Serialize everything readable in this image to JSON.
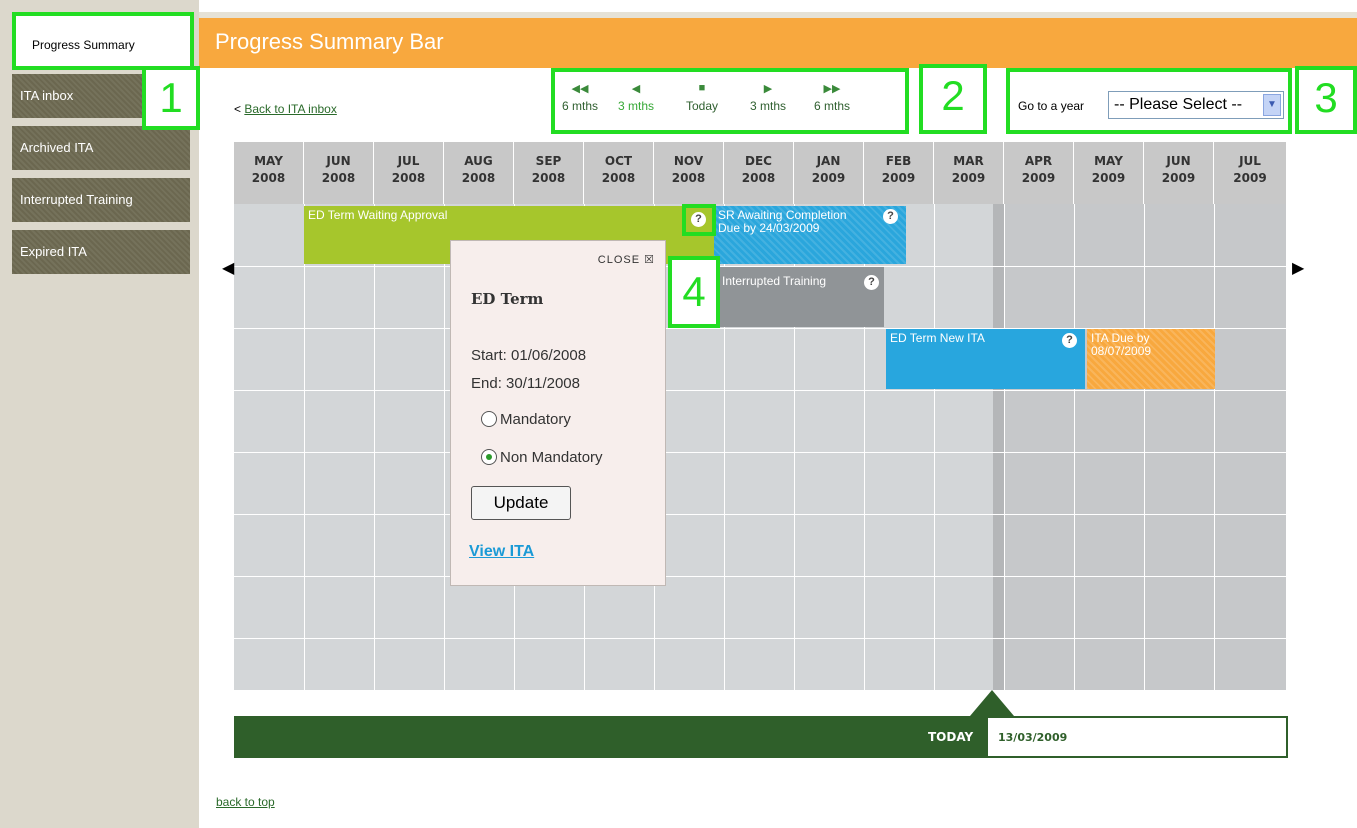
{
  "sidebar": {
    "items": [
      {
        "label": "Progress Summary"
      },
      {
        "label": "ITA inbox"
      },
      {
        "label": "Archived ITA"
      },
      {
        "label": "Interrupted Training"
      },
      {
        "label": "Expired ITA"
      }
    ]
  },
  "header": {
    "title": "Progress Summary Bar"
  },
  "back_link": {
    "prefix": "< ",
    "label": "Back to ITA inbox"
  },
  "nav": {
    "buttons": [
      {
        "icon": "double-left-arrow-icon",
        "glyph": "◀◀",
        "label": "6 mths"
      },
      {
        "icon": "left-arrow-icon",
        "glyph": "◀",
        "label": "3 mths"
      },
      {
        "icon": "stop-square-icon",
        "glyph": "■",
        "label": "Today"
      },
      {
        "icon": "right-arrow-icon",
        "glyph": "▶",
        "label": "3 mths"
      },
      {
        "icon": "double-right-arrow-icon",
        "glyph": "▶▶",
        "label": "6 mths"
      }
    ]
  },
  "year_select": {
    "label": "Go to a year",
    "value": "-- Please Select --"
  },
  "callouts": [
    "1",
    "2",
    "3",
    "4"
  ],
  "months": [
    {
      "m": "MAY",
      "y": "2008"
    },
    {
      "m": "JUN",
      "y": "2008"
    },
    {
      "m": "JUL",
      "y": "2008"
    },
    {
      "m": "AUG",
      "y": "2008"
    },
    {
      "m": "SEP",
      "y": "2008"
    },
    {
      "m": "OCT",
      "y": "2008"
    },
    {
      "m": "NOV",
      "y": "2008"
    },
    {
      "m": "DEC",
      "y": "2008"
    },
    {
      "m": "JAN",
      "y": "2009"
    },
    {
      "m": "FEB",
      "y": "2009"
    },
    {
      "m": "MAR",
      "y": "2009"
    },
    {
      "m": "APR",
      "y": "2009"
    },
    {
      "m": "MAY",
      "y": "2009"
    },
    {
      "m": "JUN",
      "y": "2009"
    },
    {
      "m": "JUL",
      "y": "2009"
    }
  ],
  "bars": {
    "ed_term": "ED Term Waiting Approval",
    "sr_awaiting": "SR Awaiting Completion Due by 24/03/2009",
    "interrupted": "Interrupted Training",
    "ed_new": "ED Term New ITA",
    "ita_due": "ITA Due by 08/07/2009",
    "help_glyph": "?"
  },
  "popup": {
    "close": "CLOSE ☒",
    "title": "ED Term",
    "start": "Start: 01/06/2008",
    "end": "End: 30/11/2008",
    "mandatory": "Mandatory",
    "non_mandatory": "Non Mandatory",
    "selected": "Non Mandatory",
    "update": "Update",
    "view": "View ITA"
  },
  "today": {
    "label": "TODAY",
    "date": "13/03/2009"
  },
  "footer": {
    "back_to_top": "back to top"
  },
  "colors": {
    "header": "#f8a83e",
    "green": "#2f5f2a",
    "highlight": "#22dd22"
  }
}
